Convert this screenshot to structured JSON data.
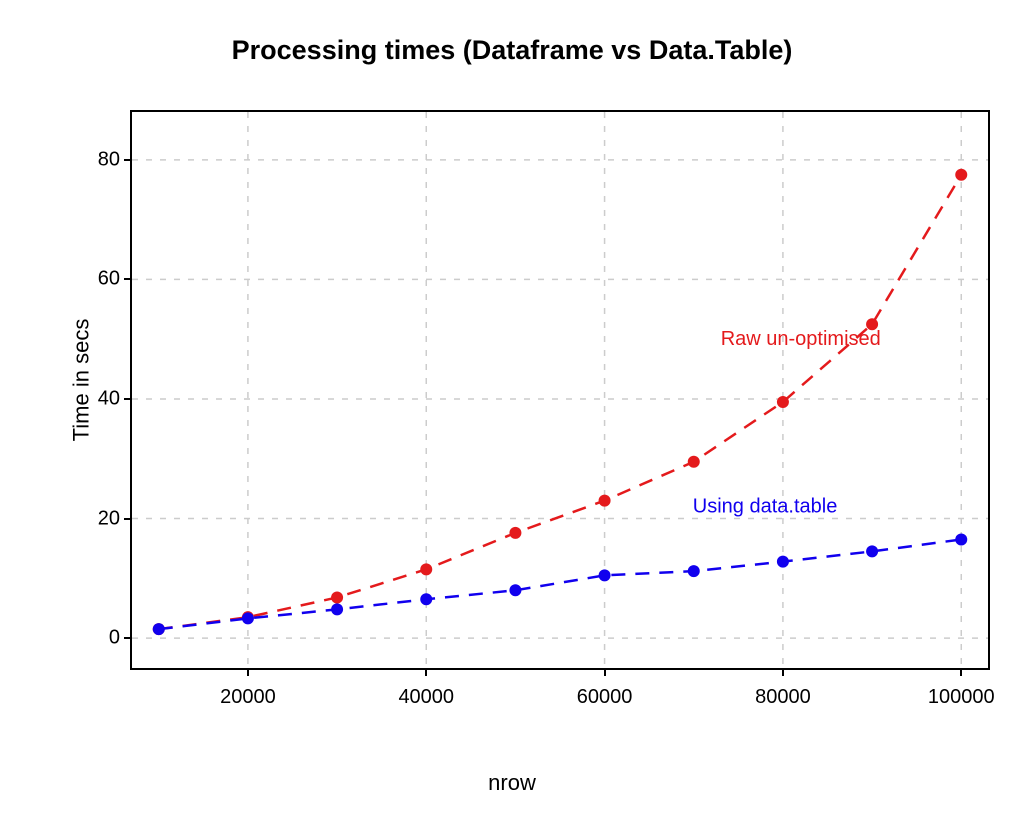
{
  "chart_data": {
    "type": "line",
    "title": "Processing times (Dataframe vs Data.Table)",
    "xlabel": "nrow",
    "ylabel": "Time in secs",
    "xlim": [
      7000,
      103000
    ],
    "ylim": [
      -5,
      88
    ],
    "xticks": [
      20000,
      40000,
      60000,
      80000,
      100000
    ],
    "yticks": [
      0,
      20,
      40,
      60,
      80
    ],
    "x": [
      10000,
      20000,
      30000,
      40000,
      50000,
      60000,
      70000,
      80000,
      90000,
      100000
    ],
    "series": [
      {
        "name": "Raw un-optimised",
        "color": "#e41a1c",
        "values": [
          1.5,
          3.5,
          6.8,
          11.5,
          17.6,
          23.0,
          29.5,
          39.5,
          52.5,
          77.5
        ],
        "annotation": {
          "x": 82000,
          "y": 49,
          "text": "Raw un-optimised"
        }
      },
      {
        "name": "Using data.table",
        "color": "#1100ee",
        "values": [
          1.5,
          3.3,
          4.8,
          6.5,
          8.0,
          10.5,
          11.2,
          12.8,
          14.5,
          16.5
        ],
        "annotation": {
          "x": 78000,
          "y": 21,
          "text": "Using data.table"
        }
      }
    ]
  }
}
